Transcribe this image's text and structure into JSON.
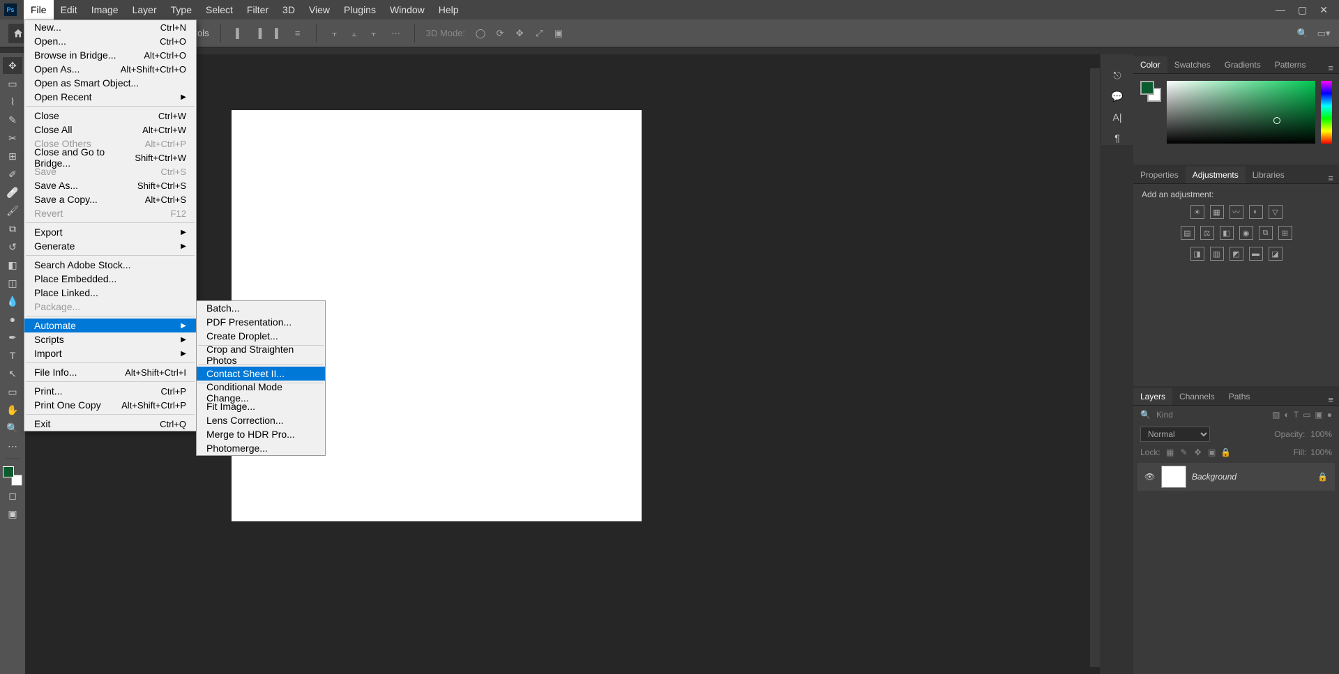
{
  "app": {
    "name": "Ps"
  },
  "menu": {
    "items": [
      "File",
      "Edit",
      "Image",
      "Layer",
      "Type",
      "Select",
      "Filter",
      "3D",
      "View",
      "Plugins",
      "Window",
      "Help"
    ],
    "open": "File"
  },
  "fileMenu": [
    {
      "label": "New...",
      "shortcut": "Ctrl+N"
    },
    {
      "label": "Open...",
      "shortcut": "Ctrl+O"
    },
    {
      "label": "Browse in Bridge...",
      "shortcut": "Alt+Ctrl+O"
    },
    {
      "label": "Open As...",
      "shortcut": "Alt+Shift+Ctrl+O"
    },
    {
      "label": "Open as Smart Object..."
    },
    {
      "label": "Open Recent",
      "submenu": true
    },
    {
      "sep": true
    },
    {
      "label": "Close",
      "shortcut": "Ctrl+W"
    },
    {
      "label": "Close All",
      "shortcut": "Alt+Ctrl+W"
    },
    {
      "label": "Close Others",
      "shortcut": "Alt+Ctrl+P",
      "disabled": true
    },
    {
      "label": "Close and Go to Bridge...",
      "shortcut": "Shift+Ctrl+W"
    },
    {
      "label": "Save",
      "shortcut": "Ctrl+S",
      "disabled": true
    },
    {
      "label": "Save As...",
      "shortcut": "Shift+Ctrl+S"
    },
    {
      "label": "Save a Copy...",
      "shortcut": "Alt+Ctrl+S"
    },
    {
      "label": "Revert",
      "shortcut": "F12",
      "disabled": true
    },
    {
      "sep": true
    },
    {
      "label": "Export",
      "submenu": true
    },
    {
      "label": "Generate",
      "submenu": true
    },
    {
      "sep": true
    },
    {
      "label": "Search Adobe Stock..."
    },
    {
      "label": "Place Embedded..."
    },
    {
      "label": "Place Linked..."
    },
    {
      "label": "Package...",
      "disabled": true
    },
    {
      "sep": true
    },
    {
      "label": "Automate",
      "submenu": true,
      "highlight": true
    },
    {
      "label": "Scripts",
      "submenu": true
    },
    {
      "label": "Import",
      "submenu": true
    },
    {
      "sep": true
    },
    {
      "label": "File Info...",
      "shortcut": "Alt+Shift+Ctrl+I"
    },
    {
      "sep": true
    },
    {
      "label": "Print...",
      "shortcut": "Ctrl+P"
    },
    {
      "label": "Print One Copy",
      "shortcut": "Alt+Shift+Ctrl+P"
    },
    {
      "sep": true
    },
    {
      "label": "Exit",
      "shortcut": "Ctrl+Q"
    }
  ],
  "automateSubmenu": [
    {
      "label": "Batch..."
    },
    {
      "label": "PDF Presentation..."
    },
    {
      "label": "Create Droplet..."
    },
    {
      "sep": true
    },
    {
      "label": "Crop and Straighten Photos"
    },
    {
      "sep": true
    },
    {
      "label": "Contact Sheet II...",
      "highlight": true
    },
    {
      "sep": true
    },
    {
      "label": "Conditional Mode Change..."
    },
    {
      "label": "Fit Image..."
    },
    {
      "label": "Lens Correction..."
    },
    {
      "label": "Merge to HDR Pro..."
    },
    {
      "label": "Photomerge..."
    }
  ],
  "optionsBar": {
    "showTransformControls": "Show Transform Controls",
    "mode3d": "3D Mode:"
  },
  "colorTabs": [
    "Color",
    "Swatches",
    "Gradients",
    "Patterns"
  ],
  "propsTabs": [
    "Properties",
    "Adjustments",
    "Libraries"
  ],
  "adjLabel": "Add an adjustment:",
  "layersTabs": [
    "Layers",
    "Channels",
    "Paths"
  ],
  "layers": {
    "kindLabel": "Kind",
    "blendMode": "Normal",
    "opacityLabel": "Opacity:",
    "opacityValue": "100%",
    "lockLabel": "Lock:",
    "fillLabel": "Fill:",
    "fillValue": "100%",
    "entry": {
      "name": "Background"
    }
  }
}
